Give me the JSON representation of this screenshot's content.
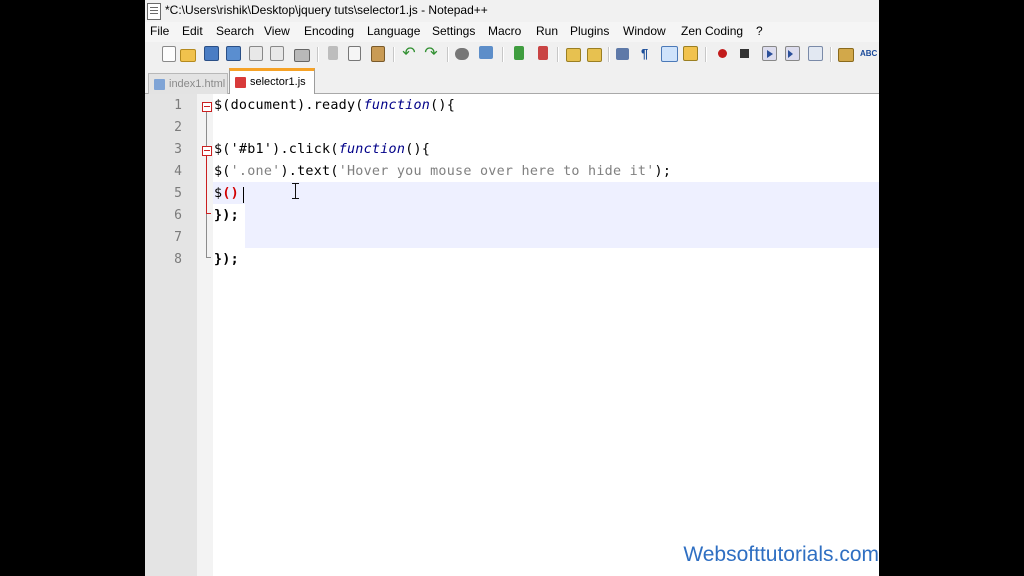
{
  "window": {
    "title": "*C:\\Users\\rishik\\Desktop\\jquery tuts\\selector1.js - Notepad++"
  },
  "menu": [
    "File",
    "Edit",
    "Search",
    "View",
    "Encoding",
    "Language",
    "Settings",
    "Macro",
    "Run",
    "Plugins",
    "Window",
    "Zen Coding",
    "?"
  ],
  "toolbar_icons": [
    "new-file-icon",
    "open-folder-icon",
    "save-icon",
    "save-all-icon",
    "close-icon",
    "close-all-icon",
    "print-icon",
    "cut-icon",
    "copy-icon",
    "paste-icon",
    "undo-icon",
    "redo-icon",
    "find-icon",
    "replace-icon",
    "zoom-in-icon",
    "zoom-out-icon",
    "sync-scroll-icon",
    "word-wrap-icon",
    "show-all-chars-icon",
    "indent-guide-icon",
    "language-icon",
    "record-macro-icon",
    "stop-macro-icon",
    "play-macro-icon",
    "run-macro-multiple-icon",
    "save-macro-icon",
    "plugin-icon",
    "spell-check-icon"
  ],
  "tabs": [
    {
      "label": "index1.html",
      "active": false
    },
    {
      "label": "selector1.js",
      "active": true
    }
  ],
  "editor": {
    "line_numbers": [
      "1",
      "2",
      "3",
      "4",
      "5",
      "6",
      "7",
      "8"
    ],
    "current_line": 5,
    "lines": {
      "l1": {
        "a": "$(document).ready(",
        "kw": "function",
        "b": "(){"
      },
      "l2": {
        "text": ""
      },
      "l3": {
        "a": "$('#b1').click(",
        "kw": "function",
        "b": "(){"
      },
      "l4": {
        "a": "$(",
        "str": "'.one'",
        "b": ").text(",
        "str2": "'Hover you mouse over here to hide it'",
        "c": ");"
      },
      "l5": {
        "a": "$",
        "paren": "()"
      },
      "l6": {
        "text": "});"
      },
      "l7": {
        "text": ""
      },
      "l8": {
        "text": "});"
      }
    }
  },
  "watermark": "Websofttutorials.com",
  "colors": {
    "keyword": "#000088",
    "string": "#808080",
    "fold_marker": "#ca2020",
    "active_tab_accent": "#f6a226",
    "current_line": "#eef0ff",
    "watermark": "#2f6fc2"
  }
}
